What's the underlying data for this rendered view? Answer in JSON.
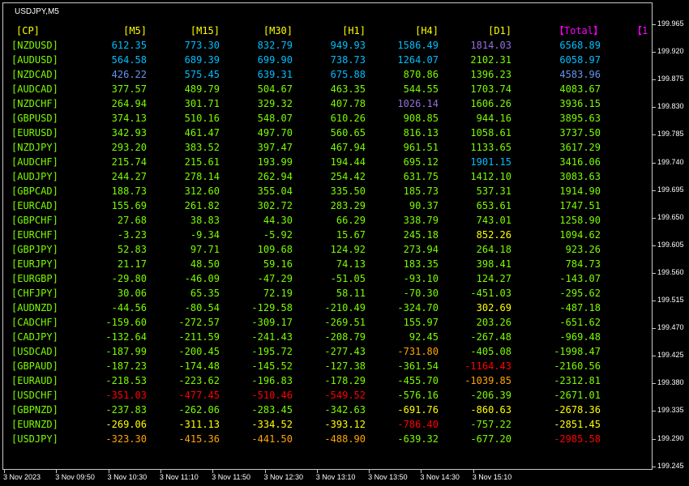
{
  "window": {
    "symbol_label": "USDJPY,M5"
  },
  "colors": {
    "header": "#ffff00",
    "total_header": "#ff00ff",
    "pair": "#7cfc00",
    "cyan": "#00bfff",
    "blue": "#6495ed",
    "purple": "#9370db",
    "lime": "#7cfc00",
    "yellow": "#ffff00",
    "orange": "#ffa500",
    "red": "#ff0000",
    "bright_pink": "#ff1493"
  },
  "table": {
    "headers": [
      "[CP]",
      "[M5]",
      "[M15]",
      "[M30]",
      "[H1]",
      "[H4]",
      "[D1]",
      "【Total】",
      "【1"
    ],
    "rows": [
      {
        "pair": "[NZDUSD]",
        "values": [
          "612.35",
          "773.30",
          "832.79",
          "949.93",
          "1586.49",
          "1814.03",
          "6568.89"
        ],
        "colors": [
          "cyan",
          "cyan",
          "cyan",
          "cyan",
          "cyan",
          "purple",
          "cyan"
        ]
      },
      {
        "pair": "[AUDUSD]",
        "values": [
          "564.58",
          "689.39",
          "699.90",
          "738.73",
          "1264.07",
          "2102.31",
          "6058.97"
        ],
        "colors": [
          "cyan",
          "cyan",
          "cyan",
          "cyan",
          "cyan",
          "lime",
          "cyan"
        ]
      },
      {
        "pair": "[NZDCAD]",
        "values": [
          "426.22",
          "575.45",
          "639.31",
          "675.88",
          "870.86",
          "1396.23",
          "4583.96"
        ],
        "colors": [
          "blue",
          "cyan",
          "cyan",
          "cyan",
          "lime",
          "lime",
          "blue"
        ]
      },
      {
        "pair": "[AUDCAD]",
        "values": [
          "377.57",
          "489.79",
          "504.67",
          "463.35",
          "544.55",
          "1703.74",
          "4083.67"
        ],
        "colors": [
          "lime",
          "lime",
          "lime",
          "lime",
          "lime",
          "lime",
          "lime"
        ]
      },
      {
        "pair": "[NZDCHF]",
        "values": [
          "264.94",
          "301.71",
          "329.32",
          "407.78",
          "1026.14",
          "1606.26",
          "3936.15"
        ],
        "colors": [
          "lime",
          "lime",
          "lime",
          "lime",
          "purple",
          "lime",
          "lime"
        ]
      },
      {
        "pair": "[GBPUSD]",
        "values": [
          "374.13",
          "510.16",
          "548.07",
          "610.26",
          "908.85",
          "944.16",
          "3895.63"
        ],
        "colors": [
          "lime",
          "lime",
          "lime",
          "lime",
          "lime",
          "lime",
          "lime"
        ]
      },
      {
        "pair": "[EURUSD]",
        "values": [
          "342.93",
          "461.47",
          "497.70",
          "560.65",
          "816.13",
          "1058.61",
          "3737.50"
        ],
        "colors": [
          "lime",
          "lime",
          "lime",
          "lime",
          "lime",
          "lime",
          "lime"
        ]
      },
      {
        "pair": "[NZDJPY]",
        "values": [
          "293.20",
          "383.52",
          "397.47",
          "467.94",
          "961.51",
          "1133.65",
          "3617.29"
        ],
        "colors": [
          "lime",
          "lime",
          "lime",
          "lime",
          "lime",
          "lime",
          "lime"
        ]
      },
      {
        "pair": "[AUDCHF]",
        "values": [
          "215.74",
          "215.61",
          "193.99",
          "194.44",
          "695.12",
          "1901.15",
          "3416.06"
        ],
        "colors": [
          "lime",
          "lime",
          "lime",
          "lime",
          "lime",
          "cyan",
          "lime"
        ]
      },
      {
        "pair": "[AUDJPY]",
        "values": [
          "244.27",
          "278.14",
          "262.94",
          "254.42",
          "631.75",
          "1412.10",
          "3083.63"
        ],
        "colors": [
          "lime",
          "lime",
          "lime",
          "lime",
          "lime",
          "lime",
          "lime"
        ]
      },
      {
        "pair": "[GBPCAD]",
        "values": [
          "188.73",
          "312.60",
          "355.04",
          "335.50",
          "185.73",
          "537.31",
          "1914.90"
        ],
        "colors": [
          "lime",
          "lime",
          "lime",
          "lime",
          "lime",
          "lime",
          "lime"
        ]
      },
      {
        "pair": "[EURCAD]",
        "values": [
          "155.69",
          "261.82",
          "302.72",
          "283.29",
          "90.37",
          "653.61",
          "1747.51"
        ],
        "colors": [
          "lime",
          "lime",
          "lime",
          "lime",
          "lime",
          "lime",
          "lime"
        ]
      },
      {
        "pair": "[GBPCHF]",
        "values": [
          "27.68",
          "38.83",
          "44.30",
          "66.29",
          "338.79",
          "743.01",
          "1258.90"
        ],
        "colors": [
          "lime",
          "lime",
          "lime",
          "lime",
          "lime",
          "lime",
          "lime"
        ]
      },
      {
        "pair": "[EURCHF]",
        "values": [
          "-3.23",
          "-9.34",
          "-5.92",
          "15.67",
          "245.18",
          "852.26",
          "1094.62"
        ],
        "colors": [
          "lime",
          "lime",
          "lime",
          "lime",
          "lime",
          "yellow",
          "lime"
        ]
      },
      {
        "pair": "[GBPJPY]",
        "values": [
          "52.83",
          "97.71",
          "109.68",
          "124.92",
          "273.94",
          "264.18",
          "923.26"
        ],
        "colors": [
          "lime",
          "lime",
          "lime",
          "lime",
          "lime",
          "lime",
          "lime"
        ]
      },
      {
        "pair": "[EURJPY]",
        "values": [
          "21.17",
          "48.50",
          "59.16",
          "74.13",
          "183.35",
          "398.41",
          "784.73"
        ],
        "colors": [
          "lime",
          "lime",
          "lime",
          "lime",
          "lime",
          "lime",
          "lime"
        ]
      },
      {
        "pair": "[EURGBP]",
        "values": [
          "-29.80",
          "-46.09",
          "-47.29",
          "-51.05",
          "-93.10",
          "124.27",
          "-143.07"
        ],
        "colors": [
          "lime",
          "lime",
          "lime",
          "lime",
          "lime",
          "lime",
          "lime"
        ]
      },
      {
        "pair": "[CHFJPY]",
        "values": [
          "30.06",
          "65.35",
          "72.19",
          "58.11",
          "-70.30",
          "-451.03",
          "-295.62"
        ],
        "colors": [
          "lime",
          "lime",
          "lime",
          "lime",
          "lime",
          "lime",
          "lime"
        ]
      },
      {
        "pair": "[AUDNZD]",
        "values": [
          "-44.56",
          "-80.54",
          "-129.58",
          "-210.49",
          "-324.70",
          "302.69",
          "-487.18"
        ],
        "colors": [
          "lime",
          "lime",
          "lime",
          "lime",
          "lime",
          "yellow",
          "lime"
        ]
      },
      {
        "pair": "[CADCHF]",
        "values": [
          "-159.60",
          "-272.57",
          "-309.17",
          "-269.51",
          "155.97",
          "203.26",
          "-651.62"
        ],
        "colors": [
          "lime",
          "lime",
          "lime",
          "lime",
          "lime",
          "lime",
          "lime"
        ]
      },
      {
        "pair": "[CADJPY]",
        "values": [
          "-132.64",
          "-211.59",
          "-241.43",
          "-208.79",
          "92.45",
          "-267.48",
          "-969.48"
        ],
        "colors": [
          "lime",
          "lime",
          "lime",
          "lime",
          "lime",
          "lime",
          "lime"
        ]
      },
      {
        "pair": "[USDCAD]",
        "values": [
          "-187.99",
          "-200.45",
          "-195.72",
          "-277.43",
          "-731.80",
          "-405.08",
          "-1998.47"
        ],
        "colors": [
          "lime",
          "lime",
          "lime",
          "lime",
          "orange",
          "lime",
          "lime"
        ]
      },
      {
        "pair": "[GBPAUD]",
        "values": [
          "-187.23",
          "-174.48",
          "-145.52",
          "-127.38",
          "-361.54",
          "-1164.43",
          "-2160.56"
        ],
        "colors": [
          "lime",
          "lime",
          "lime",
          "lime",
          "lime",
          "red",
          "lime"
        ]
      },
      {
        "pair": "[EURAUD]",
        "values": [
          "-218.53",
          "-223.62",
          "-196.83",
          "-178.29",
          "-455.70",
          "-1039.85",
          "-2312.81"
        ],
        "colors": [
          "lime",
          "lime",
          "lime",
          "lime",
          "lime",
          "orange",
          "lime"
        ]
      },
      {
        "pair": "[USDCHF]",
        "values": [
          "-351.03",
          "-477.45",
          "-510.46",
          "-549.52",
          "-576.16",
          "-206.39",
          "-2671.01"
        ],
        "colors": [
          "red",
          "red",
          "red",
          "red",
          "lime",
          "lime",
          "lime"
        ]
      },
      {
        "pair": "[GBPNZD]",
        "values": [
          "-237.83",
          "-262.06",
          "-283.45",
          "-342.63",
          "-691.76",
          "-860.63",
          "-2678.36"
        ],
        "colors": [
          "lime",
          "lime",
          "lime",
          "lime",
          "yellow",
          "yellow",
          "yellow"
        ]
      },
      {
        "pair": "[EURNZD]",
        "values": [
          "-269.06",
          "-311.13",
          "-334.52",
          "-393.12",
          "-786.40",
          "-757.22",
          "-2851.45"
        ],
        "colors": [
          "yellow",
          "yellow",
          "yellow",
          "yellow",
          "red",
          "lime",
          "yellow"
        ]
      },
      {
        "pair": "[USDJPY]",
        "values": [
          "-323.30",
          "-415.36",
          "-441.50",
          "-488.90",
          "-639.32",
          "-677.20",
          "-2985.58"
        ],
        "colors": [
          "orange",
          "orange",
          "orange",
          "orange",
          "lime",
          "lime",
          "red"
        ]
      }
    ]
  },
  "price_axis": [
    "199.965",
    "199.920",
    "199.875",
    "199.830",
    "199.785",
    "199.740",
    "199.695",
    "199.650",
    "199.605",
    "199.560",
    "199.515",
    "199.470",
    "199.425",
    "199.380",
    "199.335",
    "199.290",
    "199.245"
  ],
  "time_axis": [
    "3 Nov 2023",
    "3 Nov 09:50",
    "3 Nov 10:30",
    "3 Nov 11:10",
    "3 Nov 11:50",
    "3 Nov 12:30",
    "3 Nov 13:10",
    "3 Nov 13:50",
    "3 Nov 14:30",
    "3 Nov 15:10"
  ]
}
